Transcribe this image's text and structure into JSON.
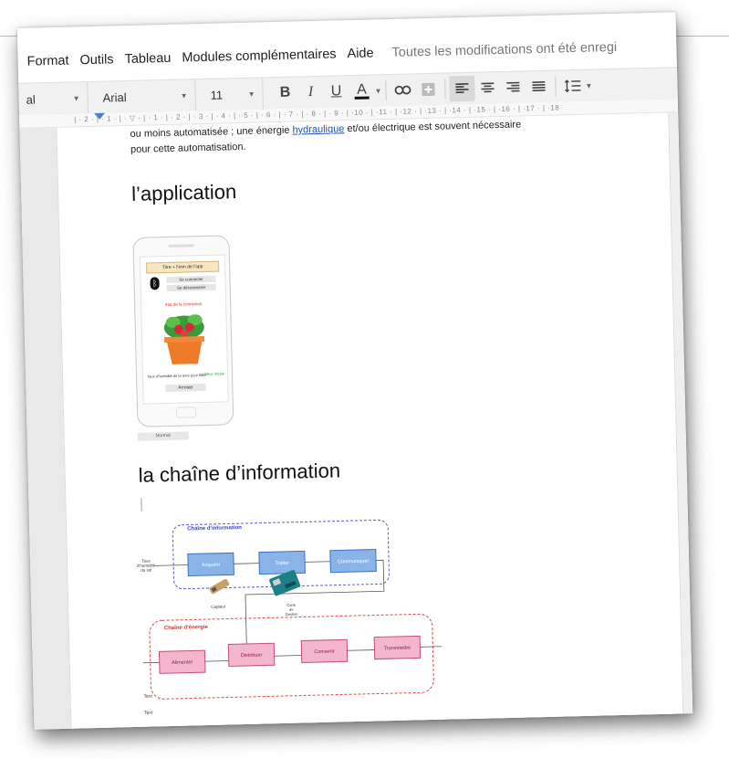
{
  "menubar": {
    "items": [
      "Format",
      "Outils",
      "Tableau",
      "Modules complémentaires",
      "Aide"
    ],
    "save_status": "Toutes les modifications ont été enregi"
  },
  "toolbar": {
    "style_value": "al",
    "font_value": "Arial",
    "size_value": "11",
    "bold": "B",
    "italic": "I",
    "underline": "U",
    "text_color": "A",
    "text_color_swatch": "#111111"
  },
  "ruler": {
    "ticks": "| · 2 · | · 1 · | · ▽ · | · 1 · | · 2 · | · 3 · | · 4 · | · 5 · | · 6 · | · 7 · | · 8 · | · 9 · | ·10 · | ·11 · | ·12 · | ·13 · | ·14 · | ·15 · | ·16 · | ·17 · | ·18"
  },
  "document": {
    "para_line1_a": "ou moins automatisée ; une énergie ",
    "para_line1_link": "hydraulique",
    "para_line1_b": " et/ou électrique est souvent nécessaire",
    "para_line2": "pour cette automatisation.",
    "heading_app": "l’application",
    "heading_chain": "la chaîne d’information",
    "normal_tag": "Normal",
    "text_labels": [
      "Text",
      "Text"
    ]
  },
  "phone": {
    "title": "Titre + Nom de l'app",
    "bluetooth": "ᛒ",
    "connect": "Se connecter",
    "disconnect": "Se déconnecter",
    "status_error": "état de la connexion",
    "left_text": "Taux d'humidité de la terre pour fleur",
    "right_text": "valeur reçue",
    "send": "Arroser"
  },
  "diagram": {
    "info_chain_title": "Chaîne d'information",
    "energy_chain_title": "Chaîne d'énergie",
    "info_input": [
      "Taux",
      "d'humidité",
      "du sol"
    ],
    "info_blocks": [
      "Acquérir",
      "Traiter",
      "Communiquer"
    ],
    "energy_blocks": [
      "Alimenter",
      "Distribuer",
      "Convertir",
      "Transmettre"
    ],
    "sensor_label": "Capteur",
    "board_label": [
      "Carte",
      "de",
      "Gestion"
    ],
    "colors": {
      "info_border": "#5b5bdc",
      "info_block_fill": "#8ab4e8",
      "info_block_border": "#3d72c4",
      "energy_border": "#e04848",
      "energy_block_fill": "#f4b6cc",
      "energy_block_border": "#c2507a",
      "arduino": "#1f7f86"
    }
  }
}
